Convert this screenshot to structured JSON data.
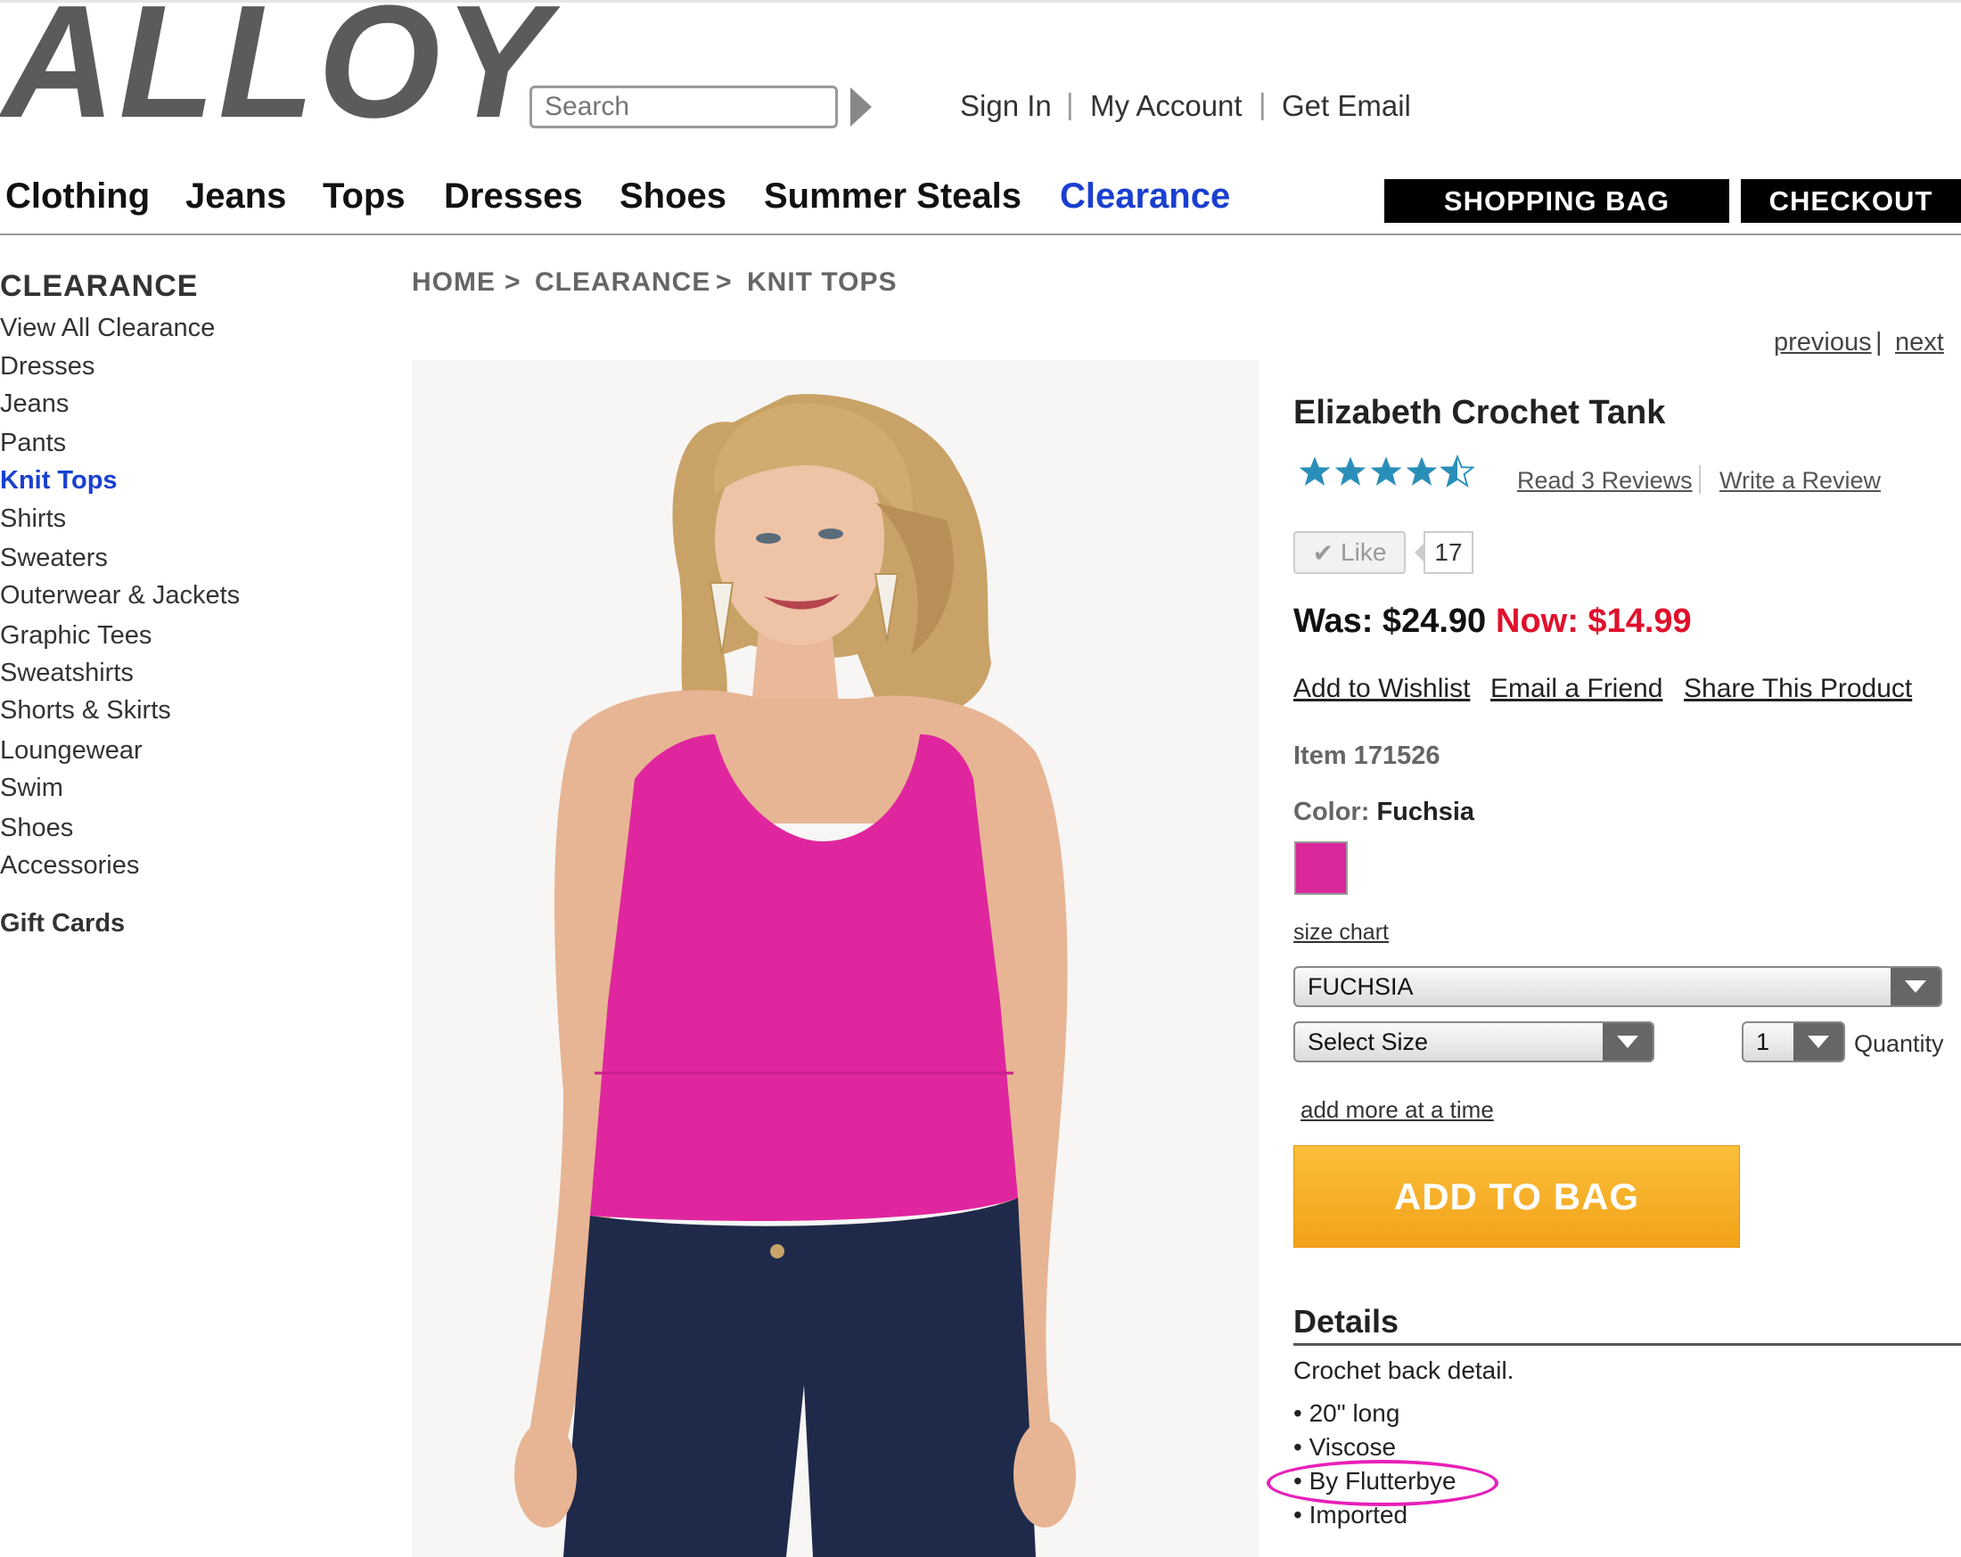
{
  "header": {
    "logo": "ALLOY",
    "search_placeholder": "Search",
    "util_links": [
      "Sign In",
      "My Account",
      "Get Email"
    ],
    "util_sep": "|"
  },
  "nav": {
    "items": [
      "Clothing",
      "Jeans",
      "Tops",
      "Dresses",
      "Shoes",
      "Summer Steals",
      "Clearance"
    ],
    "active": "Clearance",
    "shopping_bag": "SHOPPING BAG",
    "checkout": "CHECKOUT"
  },
  "sidebar": {
    "heading": "CLEARANCE",
    "items": [
      "View All Clearance",
      "Dresses",
      "Jeans",
      "Pants",
      "Knit Tops",
      "Shirts",
      "Sweaters",
      "Outerwear & Jackets",
      "Graphic Tees",
      "Sweatshirts",
      "Shorts & Skirts",
      "Loungewear",
      "Swim",
      "Shoes",
      "Accessories"
    ],
    "active": "Knit Tops",
    "gift_cards": "Gift Cards"
  },
  "breadcrumb": {
    "items": [
      "HOME",
      "CLEARANCE",
      "KNIT TOPS"
    ],
    "sep": ">"
  },
  "product": {
    "prev": "previous",
    "next": "next",
    "pager_sep": "|",
    "title": "Elizabeth Crochet Tank",
    "rating": 4.5,
    "read_reviews": "Read 3 Reviews",
    "write_review": "Write a Review",
    "like_label": "Like",
    "like_count": "17",
    "was": "Was: $24.90",
    "now": "Now: $14.99",
    "actions": [
      "Add to Wishlist",
      "Email a Friend",
      "Share This Product"
    ],
    "item_number": "Item 171526",
    "color_label": "Color:",
    "color_value": "Fuchsia",
    "swatch_color": "#d8289a",
    "size_chart": "size chart",
    "color_select": "FUCHSIA",
    "size_select": "Select Size",
    "qty_select": "1",
    "qty_label": "Quantity",
    "add_more": "add more at a time",
    "add_to_bag": "ADD TO BAG"
  },
  "details": {
    "heading": "Details",
    "description": "Crochet back detail.",
    "bullets": [
      "20\" long",
      "Viscose",
      "By Flutterbye",
      "Imported"
    ],
    "highlight_color": "#e820b8"
  }
}
